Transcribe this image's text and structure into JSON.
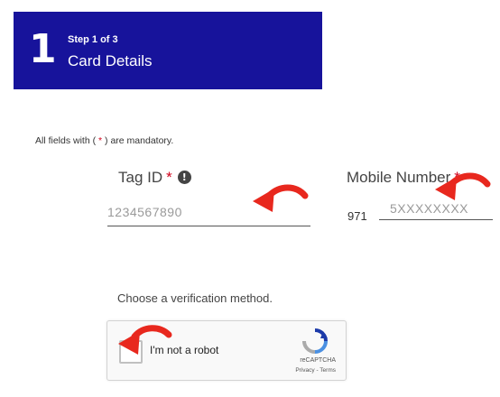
{
  "step": {
    "number": "1",
    "label": "Step 1 of 3",
    "title": "Card Details"
  },
  "form": {
    "mandatory_prefix": "All fields with ( ",
    "mandatory_asterisk": "*",
    "mandatory_suffix": " ) are mandatory.",
    "tag_id": {
      "label": "Tag ID",
      "required_mark": "*",
      "info_icon": "info-icon",
      "placeholder": "1234567890"
    },
    "mobile": {
      "label": "Mobile Number",
      "required_mark": "*",
      "country_code": "971",
      "placeholder": "5XXXXXXXX"
    },
    "verification_label": "Choose a verification method."
  },
  "captcha": {
    "label": "I'm not a robot",
    "brand": "reCAPTCHA",
    "links": "Privacy - Terms",
    "icon": "recaptcha-logo-icon"
  },
  "annotations": {
    "arrow_color": "#e8281e",
    "arrow_icon": "red-curved-arrow-icon"
  },
  "colors": {
    "banner": "#17139b",
    "required": "#d0021b"
  }
}
